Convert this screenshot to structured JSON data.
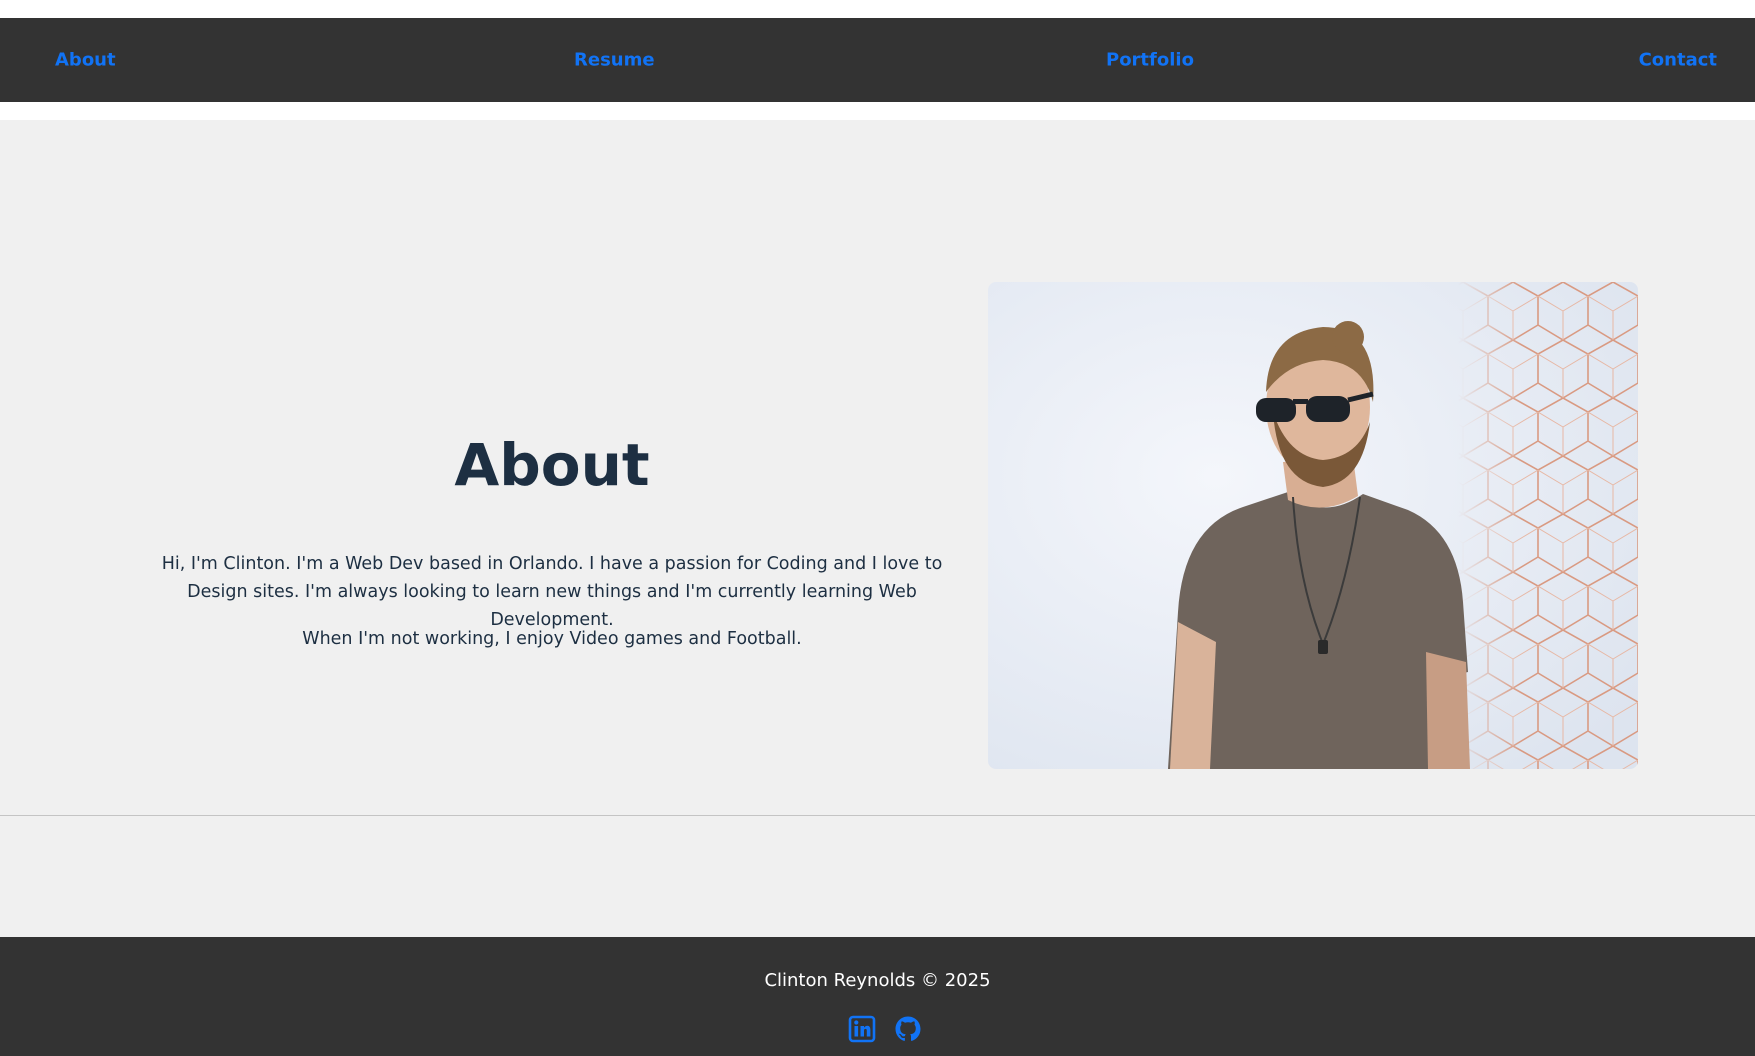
{
  "nav": {
    "about": "About",
    "resume": "Resume",
    "portfolio": "Portfolio",
    "contact": "Contact"
  },
  "about": {
    "title": "About",
    "paragraph_1": "Hi, I'm Clinton. I'm a Web Dev based in Orlando. I have a passion for Coding and I love to Design sites. I'm always looking to learn new things and I'm currently learning Web Development.",
    "paragraph_2": "When I'm not working, I enjoy Video games and Football.",
    "photo_alt": "Portrait photo"
  },
  "footer": {
    "copyright": "Clinton Reynolds © 2025",
    "icons": [
      "linkedin-icon",
      "github-icon"
    ]
  },
  "colors": {
    "nav_bg": "#333333",
    "link": "#1173f5",
    "section_bg": "#f0f0f0",
    "heading": "#1d2f42"
  }
}
